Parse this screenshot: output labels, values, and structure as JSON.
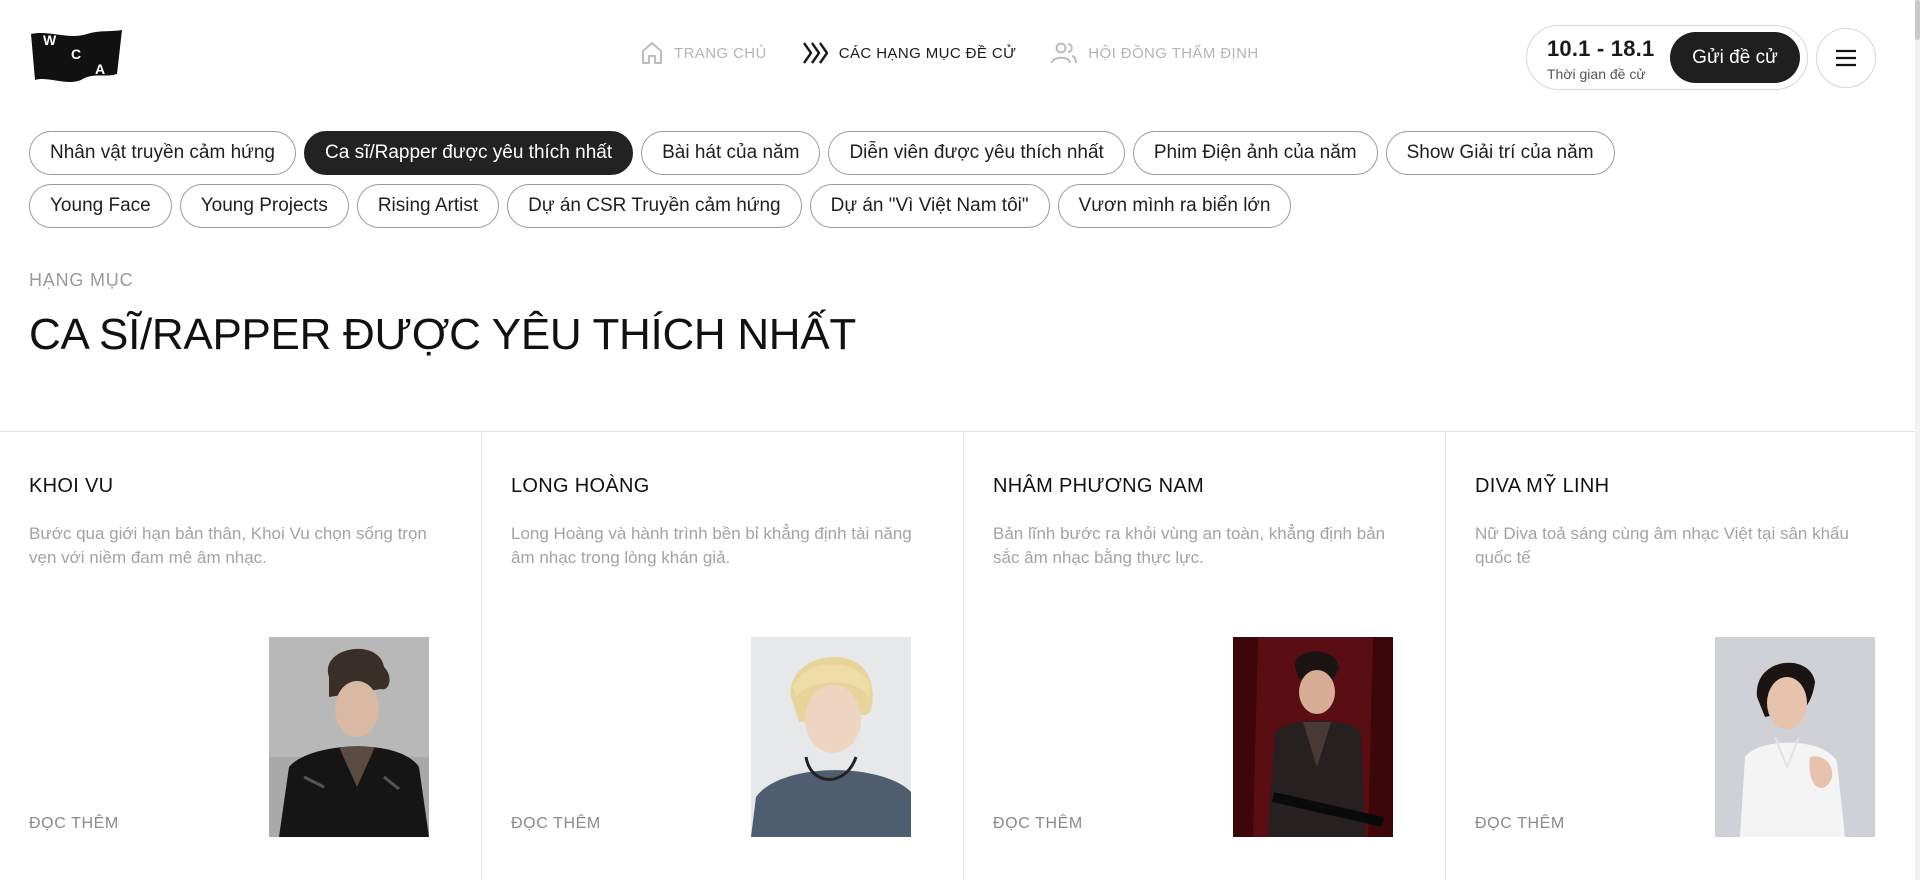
{
  "brand": {
    "logo_letters": [
      "W",
      "C",
      "A"
    ]
  },
  "nav": {
    "items": [
      {
        "label": "TRANG CHỦ",
        "icon": "home-icon",
        "active": false
      },
      {
        "label": "CÁC HẠNG MỤC ĐỀ CỬ",
        "icon": "chevrons-icon",
        "active": true
      },
      {
        "label": "HỘI ĐỒNG THẨM ĐỊNH",
        "icon": "users-icon",
        "active": false
      }
    ]
  },
  "nomination": {
    "dates": "10.1 - 18.1",
    "label": "Thời gian đề cử",
    "submit_label": "Gửi đề cử"
  },
  "menu": {
    "icon": "hamburger-icon"
  },
  "categories": {
    "row1": [
      "Nhân vật truyền cảm hứng",
      "Ca sĩ/Rapper được yêu thích nhất",
      "Bài hát của năm",
      "Diễn viên được yêu thích nhất",
      "Phim Điện ảnh của năm",
      "Show Giải trí của năm"
    ],
    "row2": [
      "Young Face",
      "Young Projects",
      "Rising Artist",
      "Dự án CSR Truyền cảm hứng",
      "Dự án \"Vì Việt Nam tôi\"",
      "Vươn mình ra biển lớn"
    ],
    "active": "Ca sĩ/Rapper được yêu thích nhất"
  },
  "section": {
    "eyebrow": "HẠNG MỤC",
    "title": "CA SĨ/RAPPER ĐƯỢC YÊU THÍCH NHẤT"
  },
  "nominees": [
    {
      "name": "KHOI VU",
      "desc": "Bước qua giới hạn bản thân, Khoi Vu chọn sống trọn vẹn với niềm đam mê âm nhạc.",
      "more": "ĐỌC THÊM"
    },
    {
      "name": "LONG HOÀNG",
      "desc": "Long Hoàng và hành trình bền bỉ khẳng định tài năng âm nhạc trong lòng khán giả.",
      "more": "ĐỌC THÊM"
    },
    {
      "name": "NHÂM PHƯƠNG NAM",
      "desc": "Bản lĩnh bước ra khỏi vùng an toàn, khẳng định bản sắc âm nhạc bằng thực lực.",
      "more": "ĐỌC THÊM"
    },
    {
      "name": "DIVA MỸ LINH",
      "desc": "Nữ Diva toả sáng cùng âm nhạc Việt tại sân khấu quốc tế",
      "more": "ĐỌC THÊM"
    }
  ],
  "colors": {
    "accent": "#222222",
    "muted": "#a3a3a3",
    "border": "#e2e2e2"
  }
}
